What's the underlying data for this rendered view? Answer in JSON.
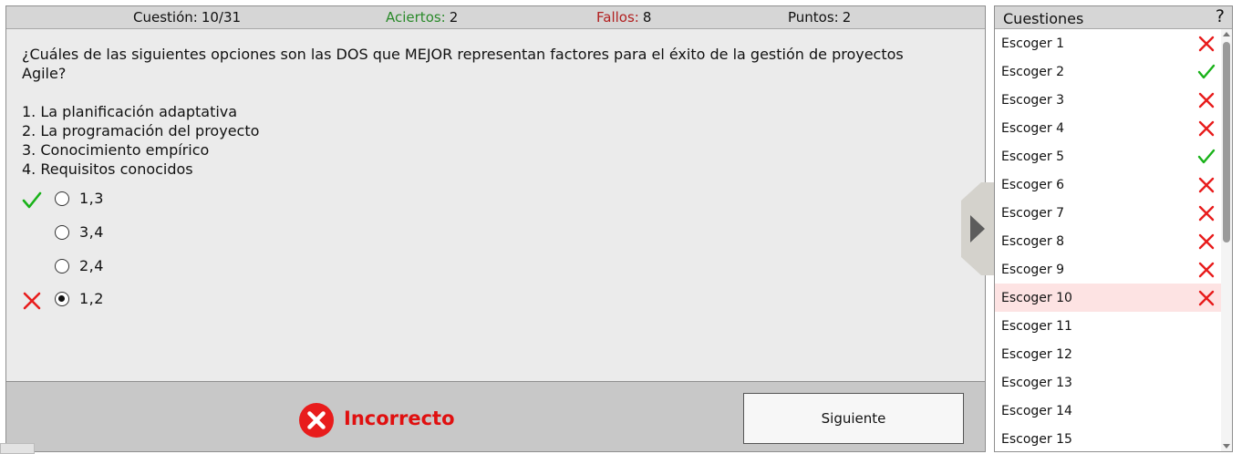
{
  "status": {
    "question_label": "Cuestión:",
    "question_value": "10/31",
    "correct_label": "Aciertos:",
    "correct_value": "2",
    "wrong_label": "Fallos:",
    "wrong_value": "8",
    "points_label": "Puntos:",
    "points_value": "2"
  },
  "question": {
    "text": "¿Cuáles de las siguientes opciones son las DOS que MEJOR representan factores para el éxito de la gestión de proyectos Agile?",
    "options": [
      "1. La planificación adaptativa",
      "2. La programación del proyecto",
      "3. Conocimiento empírico",
      "4. Requisitos conocidos"
    ]
  },
  "answers": [
    {
      "label": "1,3",
      "mark": "check-icon",
      "selected": false
    },
    {
      "label": "3,4",
      "mark": "",
      "selected": false
    },
    {
      "label": "2,4",
      "mark": "",
      "selected": false
    },
    {
      "label": "1,2",
      "mark": "cross-icon",
      "selected": true
    }
  ],
  "result": {
    "text": "Incorrecto",
    "icon": "error-circle-icon"
  },
  "next_button": "Siguiente",
  "sidebar": {
    "title": "Cuestiones",
    "help": "?",
    "items": [
      {
        "label": "Escoger 1",
        "mark": "cross"
      },
      {
        "label": "Escoger 2",
        "mark": "check"
      },
      {
        "label": "Escoger 3",
        "mark": "cross"
      },
      {
        "label": "Escoger 4",
        "mark": "cross"
      },
      {
        "label": "Escoger 5",
        "mark": "check"
      },
      {
        "label": "Escoger 6",
        "mark": "cross"
      },
      {
        "label": "Escoger 7",
        "mark": "cross"
      },
      {
        "label": "Escoger 8",
        "mark": "cross"
      },
      {
        "label": "Escoger 9",
        "mark": "cross"
      },
      {
        "label": "Escoger 10",
        "mark": "cross",
        "current": true
      },
      {
        "label": "Escoger 11",
        "mark": ""
      },
      {
        "label": "Escoger 12",
        "mark": ""
      },
      {
        "label": "Escoger 13",
        "mark": ""
      },
      {
        "label": "Escoger 14",
        "mark": ""
      },
      {
        "label": "Escoger 15",
        "mark": ""
      }
    ]
  },
  "colors": {
    "correct_green": "#2a8a2a",
    "wrong_red": "#b22020",
    "mark_red": "#e81c1c",
    "mark_green": "#19b219",
    "current_row": "#fde3e3"
  }
}
